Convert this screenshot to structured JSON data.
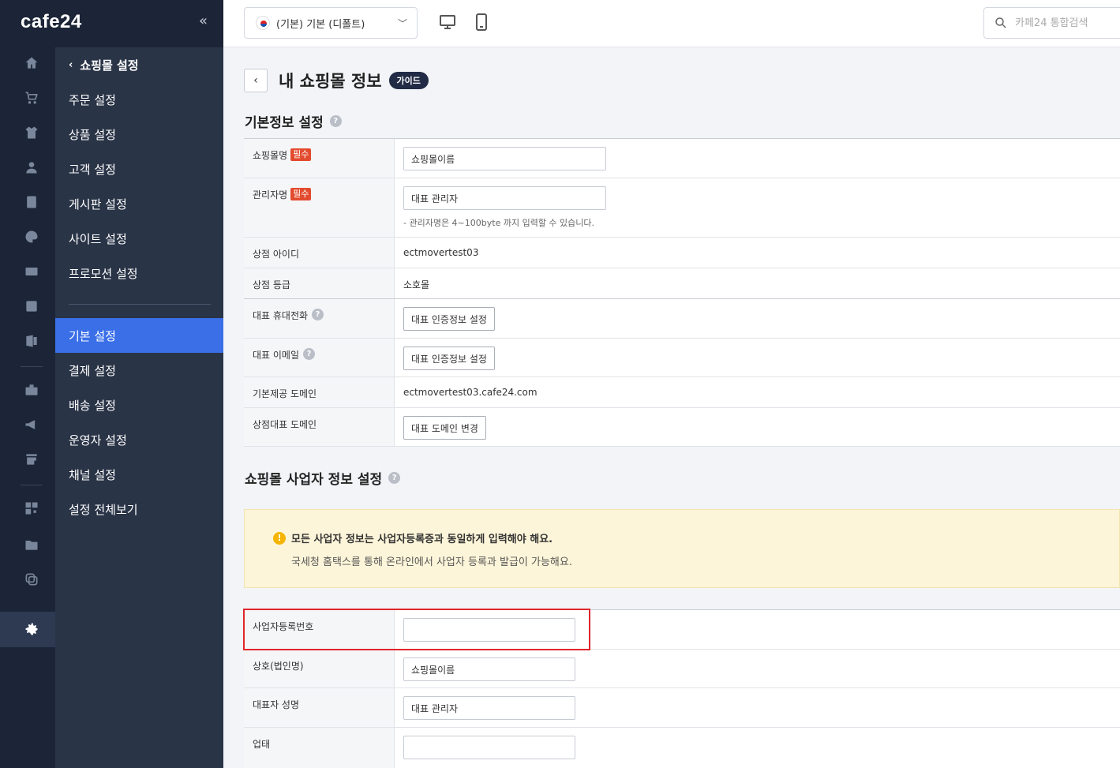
{
  "logo": "cafe24",
  "topbar": {
    "language_select": "(기본) 기본 (디폴트)",
    "search_placeholder": "카페24 통합검색"
  },
  "rail_icons": [
    "home-icon",
    "cart-icon",
    "shirt-icon",
    "user-icon",
    "board-icon",
    "palette-icon",
    "coupon-icon",
    "chart-icon",
    "store-icon",
    "briefcase-icon",
    "megaphone-icon",
    "shop-add-icon",
    "apps-icon",
    "folder-add-icon",
    "copy-icon",
    "settings-icon"
  ],
  "menu": {
    "back_label": "쇼핑몰 설정",
    "items_top": [
      "주문 설정",
      "상품 설정",
      "고객 설정",
      "게시판 설정",
      "사이트 설정",
      "프로모션 설정"
    ],
    "items_bottom": [
      "기본 설정",
      "결제 설정",
      "배송 설정",
      "운영자 설정",
      "채널 설정",
      "설정 전체보기"
    ],
    "active": "기본 설정"
  },
  "page": {
    "title": "내 쇼핑몰 정보",
    "guide_badge": "가이드"
  },
  "basic_info": {
    "section_title": "기본정보 설정",
    "required_tag": "필수",
    "rows": {
      "shop_name_label": "쇼핑몰명",
      "shop_name_value": "쇼핑몰이름",
      "admin_name_label": "관리자명",
      "admin_name_value": "대표 관리자",
      "admin_name_hint": "- 관리자명은 4~100byte 까지 입력할 수 있습니다.",
      "store_id_label": "상점 아이디",
      "store_id_value": "ectmovertest03",
      "store_grade_label": "상점 등급",
      "store_grade_value": "소호몰",
      "phone_label": "대표 휴대전화",
      "phone_button": "대표 인증정보 설정",
      "email_label": "대표 이메일",
      "email_button": "대표 인증정보 설정",
      "domain_label": "기본제공 도메인",
      "domain_value": "ectmovertest03.cafe24.com",
      "rep_domain_label": "상점대표 도메인",
      "rep_domain_button": "대표 도메인 변경"
    }
  },
  "business_info": {
    "section_title": "쇼핑몰 사업자 정보 설정",
    "notice_title": "모든 사업자 정보는 사업자등록증과 동일하게 입력해야 해요.",
    "notice_body": "국세청 홈택스를 통해 온라인에서 사업자 등록과 발급이 가능해요.",
    "rows": {
      "biz_no_label": "사업자등록번호",
      "biz_no_value": "",
      "company_label": "상호(법인명)",
      "company_value": "쇼핑몰이름",
      "ceo_label": "대표자 성명",
      "ceo_value": "대표 관리자",
      "biz_type_label": "업태",
      "biz_type_value": ""
    }
  },
  "colors": {
    "rail_bg": "#1c2537",
    "menu_bg": "#2a3447",
    "menu_active": "#3a6fe8",
    "required_tag": "#e34b2e",
    "highlight": "#e0262b",
    "notice_bg": "#fdf5d9"
  }
}
